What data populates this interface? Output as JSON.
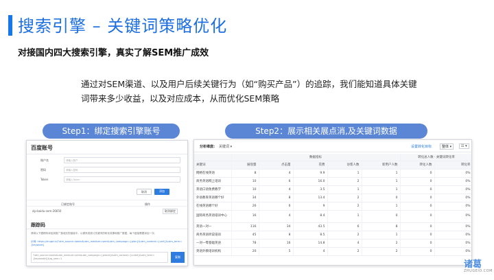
{
  "slide": {
    "title": "搜索引擎 – 关键词策略优化",
    "subtitle": "对接国内四大搜索引擎，真实了解SEM推广成效",
    "description": "通过对SEM渠道、以及用户后续关键行为（如“购买产品”）的追踪，我们能知道具体关键词带来多少收益，以及对应成本，从而优化SEM策略",
    "accent_color": "#1677e6",
    "pill_color": "#5b86d6"
  },
  "step1": {
    "label": "Step1：绑定搜索引擎账号",
    "panel_title": "百度账号",
    "fields": [
      {
        "label": "账户名",
        "placeholder": "请输入账户"
      },
      {
        "label": "密码",
        "placeholder": "请输入密码"
      },
      {
        "label": "Token",
        "placeholder": "请输入Token"
      }
    ],
    "cancel_label": "取消",
    "confirm_label": "添加",
    "accounts_header": {
      "col1": "已绑定账号",
      "col2": "操作"
    },
    "account_row": {
      "name": "zip-baidu-sem-26650",
      "action": "取消绑定"
    },
    "code_section_title": "跟踪码",
    "note1": "请将以下跟踪码添加到推广落地页的链接中，以便系统统计关键词的转化效果和推广数据，每个链接需要添加一次。",
    "note2": "示例: https://zhuge.io/?utm_source=baidu&utm_medium=sem&utm_campaign={plan}&utm_content={unit}&utm_term={keyword}",
    "code_text": "?utm_source=baidu&utm_medium=sem&utm_campaign={planid}&utm_content={unitid}&utm_term={keywordid}&zg_sem=1",
    "copy_label": "复制"
  },
  "step2": {
    "label": "Step2：展示相关展点消,及关键词数据",
    "toolbar": {
      "analyze_label": "分析维度:",
      "dim_value": "关键词 ▾",
      "link_label": "设置转化目标",
      "view_label": "整体 ▾",
      "menu_label": "☷ ▾"
    },
    "group_headers": {
      "engine": "数据指标",
      "conversion": "转化总人数 · 关键词转化率"
    },
    "columns": [
      "关键词",
      "展现量",
      "点击量",
      "花费",
      "访客人数",
      "新用户人数",
      "转化人数",
      "转化率"
    ],
    "rows": [
      [
        "网络在线英语",
        "8",
        "4",
        "9.9",
        "1",
        "1",
        "0",
        "0%"
      ],
      [
        "商务英语网上培训",
        "10",
        "6",
        "16.0",
        "2",
        "1",
        "0",
        "0%"
      ],
      [
        "英语口语免费教学",
        "10",
        "4",
        "3.5",
        "1",
        "1",
        "0",
        "0%"
      ],
      [
        "外语教育英语哪个好",
        "34",
        "8",
        "13.4",
        "2",
        "0",
        "0",
        "0%"
      ],
      [
        "在线英语哪个好",
        "26",
        "6",
        "9",
        "2",
        "1",
        "0",
        "0%"
      ],
      [
        "国际商务英语培训中心",
        "16",
        "4",
        "8.4",
        "1",
        "0",
        "0",
        "0%"
      ],
      [
        "英语一对一",
        "116",
        "34",
        "43.5",
        "6",
        "8",
        "0",
        "0%"
      ],
      [
        "商务英语听说培训",
        "45",
        "8",
        "8.5",
        "2",
        "1",
        "0",
        "0%"
      ],
      [
        "一对一零基础英语",
        "78",
        "16",
        "14.8",
        "4",
        "2",
        "0",
        "0%"
      ],
      [
        "英语外教培训机构",
        "20",
        "5",
        "4",
        "2",
        "2",
        "0",
        "0%"
      ]
    ]
  },
  "logo": {
    "mark": "诸葛",
    "sub": "ZHUGEIO.COM"
  }
}
